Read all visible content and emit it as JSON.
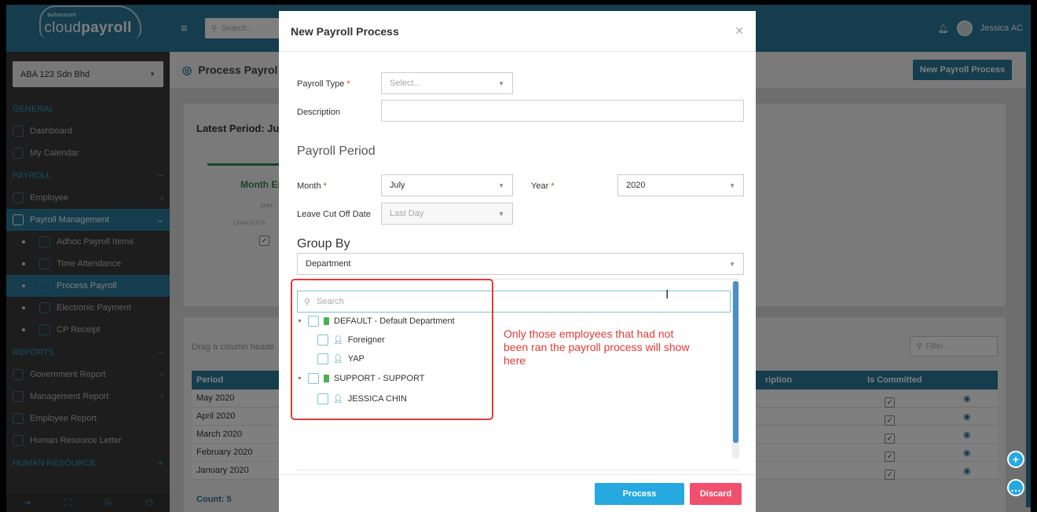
{
  "app": {
    "logo_small": "autocount",
    "logo_main_a": "cloud",
    "logo_main_b": "payroll",
    "company": "ABA 123 Sdn Bhd",
    "search_placeholder": "Search...",
    "user": "Jessica AC"
  },
  "sidebar": {
    "general": "GENERAL",
    "payroll": "PAYROLL",
    "reports": "REPORTS",
    "human_resource": "HUMAN RESOURCE",
    "items": [
      {
        "label": "Dashboard"
      },
      {
        "label": "My Calendar"
      },
      {
        "label": "Employee"
      },
      {
        "label": "Payroll Management"
      },
      {
        "label": "Adhoc Payroll Items"
      },
      {
        "label": "Time Attendance"
      },
      {
        "label": "Process Payroll"
      },
      {
        "label": "Electronic Payment"
      },
      {
        "label": "CP Receipt"
      },
      {
        "label": "Government Report"
      },
      {
        "label": "Management Report"
      },
      {
        "label": "Employee Report"
      },
      {
        "label": "Human Resource Letter"
      }
    ]
  },
  "page": {
    "title": "Process Payrol",
    "new_button": "New Payroll Process",
    "latest_period": "Latest Period: Ju",
    "month_end": "Month En",
    "tiny1": "EMPL",
    "tiny2": "LEAVE CUT O",
    "drag_hint": "Drag a column heade",
    "filter_placeholder": "Filter...",
    "columns": {
      "period": "Period",
      "description": "ription",
      "committed": "Is Committed"
    },
    "rows": [
      {
        "period": "May 2020"
      },
      {
        "period": "April 2020"
      },
      {
        "period": "March 2020"
      },
      {
        "period": "February 2020"
      },
      {
        "period": "January 2020"
      }
    ],
    "count": "Count: 5"
  },
  "modal": {
    "title": "New Payroll Process",
    "payroll_type_label": "Payroll Type",
    "payroll_type_placeholder": "Select...",
    "description_label": "Description",
    "description_value": "",
    "payroll_period_heading": "Payroll Period",
    "month_label": "Month",
    "month_value": "July",
    "year_label": "Year",
    "year_value": "2020",
    "leave_label": "Leave Cut Off Date",
    "leave_value": "Last Day",
    "group_by_heading": "Group By",
    "group_by_value": "Department",
    "tree_search_placeholder": "Search",
    "tree": [
      {
        "label": "DEFAULT - Default Department",
        "children": [
          "Foreigner",
          "YAP"
        ]
      },
      {
        "label": "SUPPORT - SUPPORT",
        "children": [
          "JESSICA CHIN"
        ]
      }
    ],
    "annotation": "Only those employees that had not been ran the payroll process will show here",
    "process_button": "Process",
    "discard_button": "Discard"
  },
  "colors": {
    "primary": "#2a7a9a",
    "process": "#26a9e0",
    "discard": "#f0506e",
    "annotation": "#e53935"
  }
}
